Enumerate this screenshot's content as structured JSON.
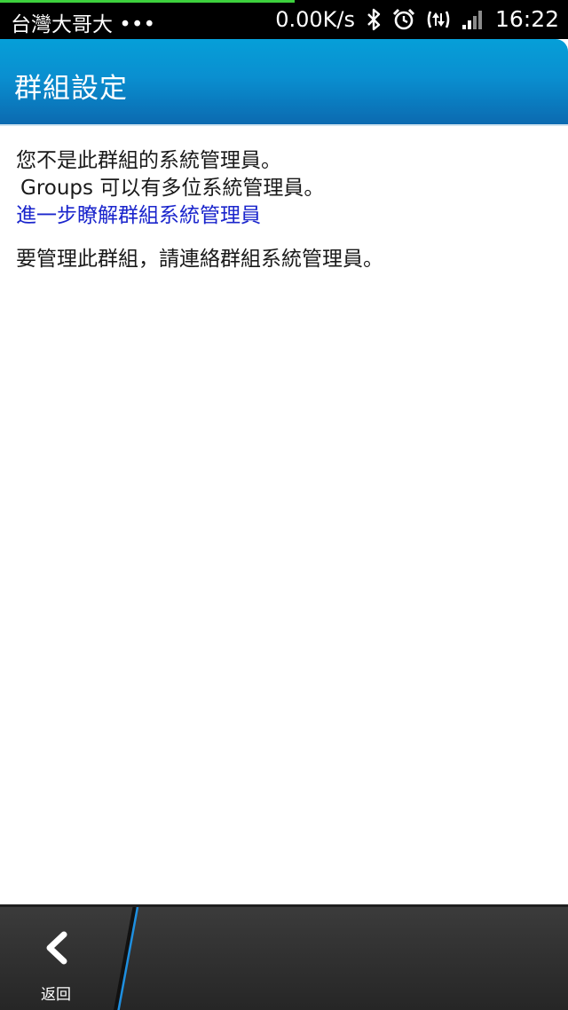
{
  "status_bar": {
    "carrier": "台灣大哥大 •••",
    "net_speed": "0.00K/s",
    "time": "16:22",
    "icons": [
      "bluetooth-icon",
      "alarm-icon",
      "data-transfer-icon",
      "signal-icon"
    ]
  },
  "header": {
    "title": "群組設定"
  },
  "content": {
    "not_admin": "您不是此群組的系統管理員。",
    "multi_admin": "Groups 可以有多位系統管理員。",
    "learn_more": "進一步瞭解群組系統管理員",
    "contact_admin": "要管理此群組，請連絡群組系統管理員。"
  },
  "bottom_bar": {
    "back_label": "返回",
    "back_icon": "chevron-left-icon"
  },
  "colors": {
    "header_top": "#069fd8",
    "header_bottom": "#0b6ab0",
    "link": "#1a25cc",
    "accent_line": "#1e8fe0",
    "progress": "#3dd13d"
  }
}
